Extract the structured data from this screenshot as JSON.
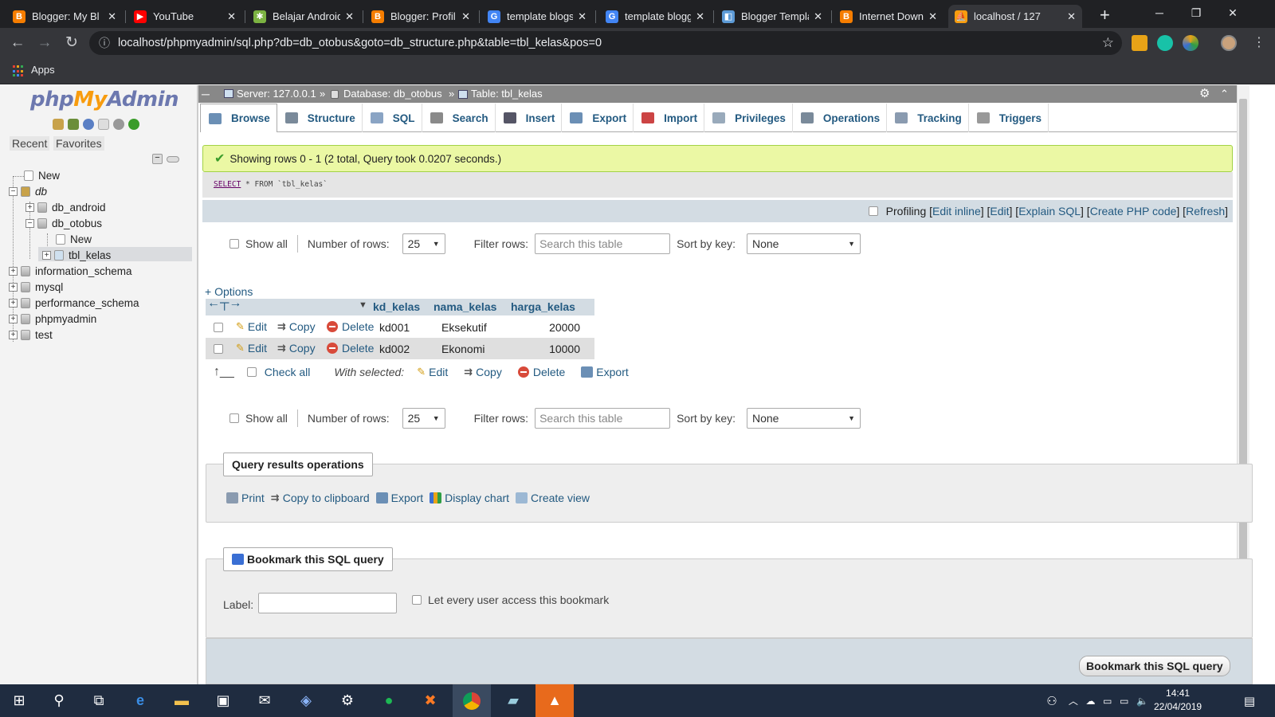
{
  "browser": {
    "tabs": [
      {
        "title": "Blogger: My Bl",
        "color": "#f57d00",
        "glyph": "B"
      },
      {
        "title": "YouTube",
        "color": "#ff0000",
        "glyph": "▶"
      },
      {
        "title": "Belajar Android",
        "color": "#7cb342",
        "glyph": "✱"
      },
      {
        "title": "Blogger: Profil",
        "color": "#f57d00",
        "glyph": "B"
      },
      {
        "title": "template blogs",
        "color": "#4285f4",
        "glyph": "G"
      },
      {
        "title": "template blogg",
        "color": "#4285f4",
        "glyph": "G"
      },
      {
        "title": "Blogger Templa",
        "color": "#5c9ad6",
        "glyph": "◧"
      },
      {
        "title": "Internet Downl",
        "color": "#f57d00",
        "glyph": "B"
      },
      {
        "title": "localhost / 127",
        "color": "#f89c0e",
        "glyph": "⛵"
      }
    ],
    "url": "localhost/phpmyadmin/sql.php?db=db_otobus&goto=db_structure.php&table=tbl_kelas&pos=0",
    "bookmarks_apps": "Apps"
  },
  "nav": {
    "logo": {
      "php": "php",
      "my": "My",
      "admin": "Admin"
    },
    "recent": "Recent",
    "favorites": "Favorites",
    "tree": {
      "new": "New",
      "db": "db",
      "db_android": "db_android",
      "db_otobus": "db_otobus",
      "otobus_new": "New",
      "tbl_kelas": "tbl_kelas",
      "information_schema": "information_schema",
      "mysql": "mysql",
      "performance_schema": "performance_schema",
      "phpmyadmin": "phpmyadmin",
      "test": "test"
    }
  },
  "breadcrumb": {
    "server": "Server: 127.0.0.1",
    "database": "Database: db_otobus",
    "table": "Table: tbl_kelas",
    "sep": "»"
  },
  "tabs": [
    "Browse",
    "Structure",
    "SQL",
    "Search",
    "Insert",
    "Export",
    "Import",
    "Privileges",
    "Operations",
    "Tracking",
    "Triggers"
  ],
  "message": "Showing rows 0 - 1 (2 total, Query took 0.0207 seconds.)",
  "sql": {
    "keyword": "SELECT",
    "rest": " * FROM `tbl_kelas`"
  },
  "sql_actions": {
    "profiling": "Profiling",
    "edit_inline": "Edit inline",
    "edit": "Edit",
    "explain": "Explain SQL",
    "create_php": "Create PHP code",
    "refresh": "Refresh"
  },
  "navbar": {
    "show_all": "Show all",
    "number_of_rows": "Number of rows:",
    "rows_value": "25",
    "filter_rows": "Filter rows:",
    "filter_placeholder": "Search this table",
    "sort_by_key": "Sort by key:",
    "sort_value": "None"
  },
  "options": "+ Options",
  "table": {
    "columns": [
      "kd_kelas",
      "nama_kelas",
      "harga_kelas"
    ],
    "rows": [
      {
        "kd_kelas": "kd001",
        "nama_kelas": "Eksekutif",
        "harga_kelas": "20000"
      },
      {
        "kd_kelas": "kd002",
        "nama_kelas": "Ekonomi",
        "harga_kelas": "10000"
      }
    ],
    "edit": "Edit",
    "copy": "Copy",
    "delete": "Delete"
  },
  "with_selected": {
    "check_all": "Check all",
    "label": "With selected:",
    "edit": "Edit",
    "copy": "Copy",
    "delete": "Delete",
    "export": "Export"
  },
  "query_ops": {
    "legend": "Query results operations",
    "print": "Print",
    "copy_clipboard": "Copy to clipboard",
    "export": "Export",
    "display_chart": "Display chart",
    "create_view": "Create view"
  },
  "bookmark": {
    "legend": "Bookmark this SQL query",
    "label": "Label:",
    "let_every_user": "Let every user access this bookmark",
    "button": "Bookmark this SQL query"
  },
  "clock": {
    "time": "14:41",
    "date": "22/04/2019"
  }
}
